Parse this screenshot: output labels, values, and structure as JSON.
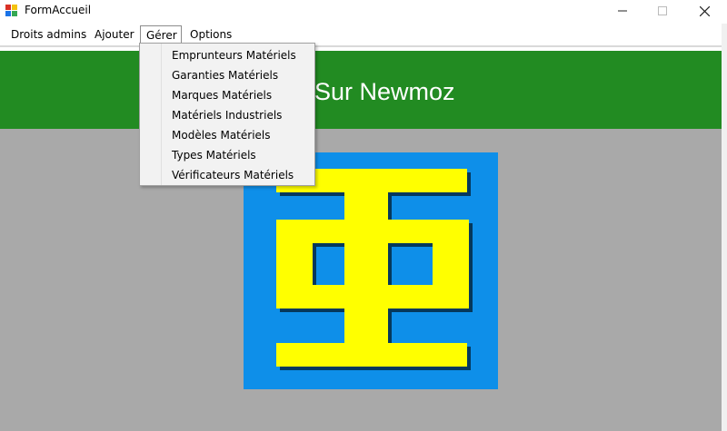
{
  "window": {
    "title": "FormAccueil",
    "controls": {
      "minimize": "–",
      "maximize": "☐",
      "close": "✕"
    }
  },
  "menubar": {
    "items": [
      {
        "label": "Droits admins"
      },
      {
        "label": "Ajouter"
      },
      {
        "label": "Gérer",
        "active": true
      },
      {
        "label": "Options"
      }
    ]
  },
  "banner": {
    "text": "nue Sur Newmoz",
    "color": "#228b22"
  },
  "dropdown": {
    "items": [
      {
        "label": "Emprunteurs Matériels"
      },
      {
        "label": "Garanties Matériels"
      },
      {
        "label": "Marques Matériels"
      },
      {
        "label": "Matériels Industriels"
      },
      {
        "label": "Modèles Matériels"
      },
      {
        "label": "Types Matériels"
      },
      {
        "label": "Vérificateurs Matériels"
      }
    ]
  },
  "logo": {
    "icon": "newmoz-logo-icon",
    "background_color": "#0e8fe9",
    "glyph_color": "#ffff00"
  },
  "colors": {
    "content_background": "#a9a9a9"
  }
}
